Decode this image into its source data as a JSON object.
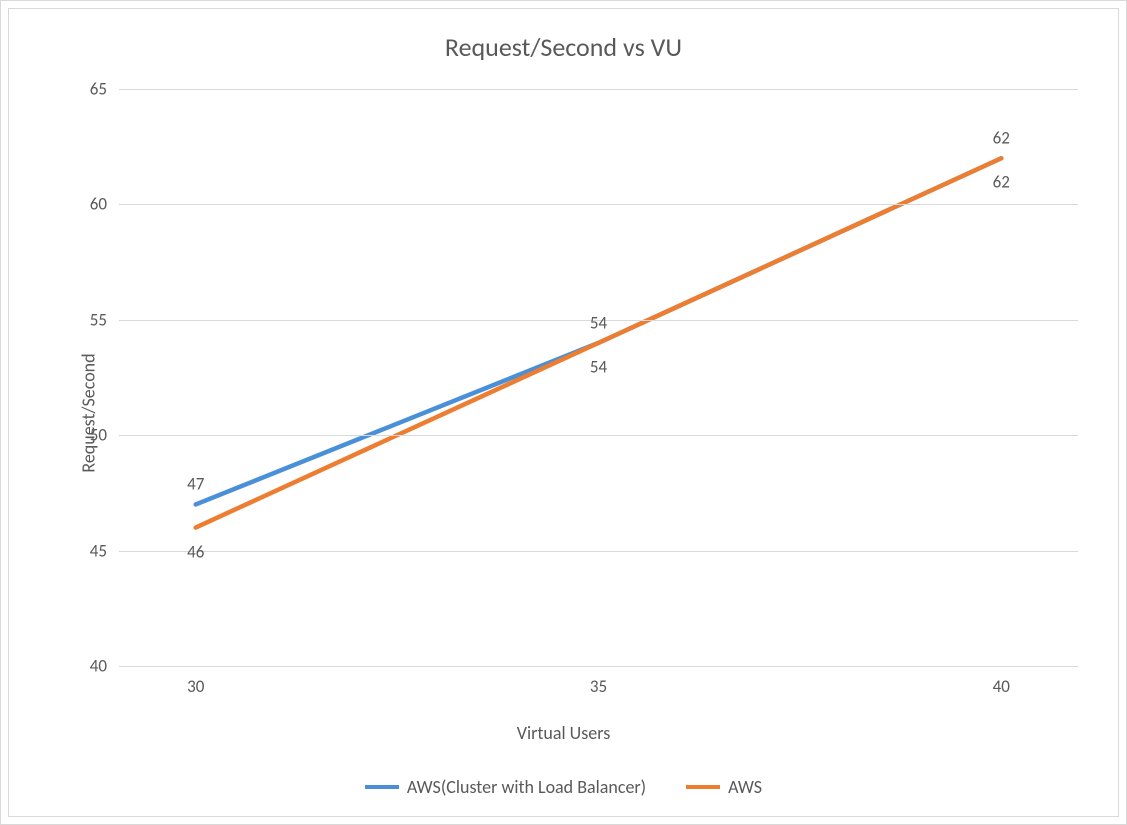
{
  "chart_data": {
    "type": "line",
    "title": "Request/Second  vs VU",
    "xlabel": "Virtual Users",
    "ylabel": "Request/Second",
    "categories": [
      "30",
      "35",
      "40"
    ],
    "xticks": [
      "30",
      "35",
      "40"
    ],
    "yticks": [
      "40",
      "45",
      "50",
      "55",
      "60",
      "65"
    ],
    "ylim": [
      40,
      65
    ],
    "series": [
      {
        "name": "AWS(Cluster with Load Balancer)",
        "values": [
          47,
          54,
          62
        ],
        "color": "#4A90D9",
        "label_offset": "above"
      },
      {
        "name": "AWS",
        "values": [
          46,
          54,
          62
        ],
        "color": "#ED7D31",
        "label_offset": "below"
      }
    ],
    "grid": {
      "y": true,
      "x": false
    },
    "legend_position": "bottom"
  }
}
